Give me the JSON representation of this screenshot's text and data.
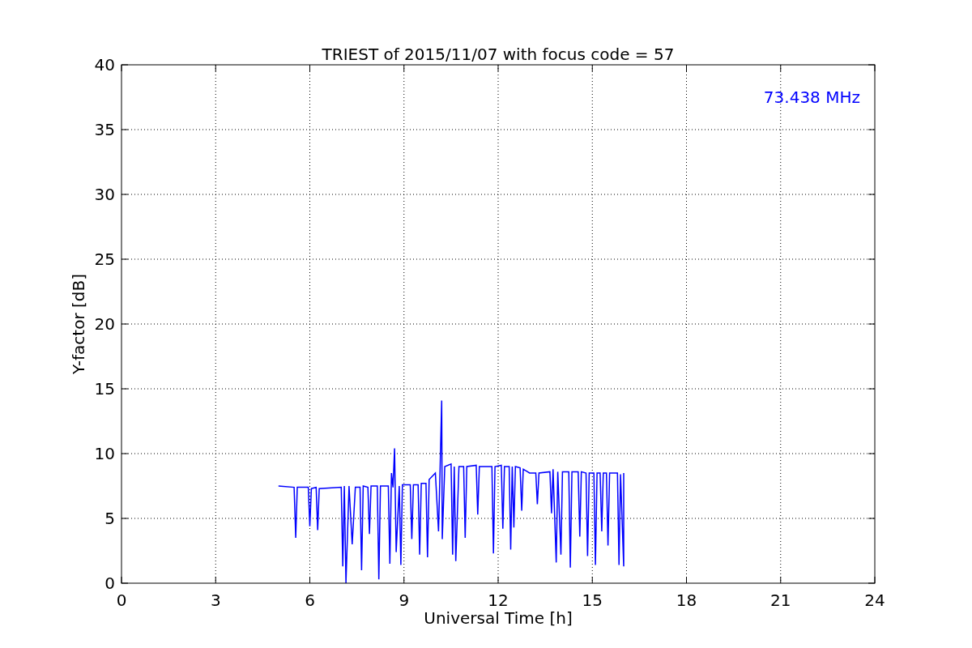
{
  "chart_data": {
    "type": "line",
    "title": "TRIEST of 2015/11/07 with focus code = 57",
    "xlabel": "Universal Time [h]",
    "ylabel": "Y-factor [dB]",
    "xlim": [
      0,
      24
    ],
    "ylim": [
      0,
      40
    ],
    "xticks": [
      0,
      3,
      6,
      9,
      12,
      15,
      18,
      21,
      24
    ],
    "yticks": [
      0,
      5,
      10,
      15,
      20,
      25,
      30,
      35,
      40
    ],
    "x": [
      5.0,
      5.5,
      5.55,
      5.6,
      5.95,
      6.0,
      6.05,
      6.2,
      6.25,
      6.3,
      7.0,
      7.05,
      7.1,
      7.15,
      7.25,
      7.35,
      7.45,
      7.6,
      7.65,
      7.7,
      7.85,
      7.9,
      7.95,
      8.15,
      8.2,
      8.25,
      8.5,
      8.55,
      8.6,
      8.65,
      8.7,
      8.75,
      8.85,
      8.9,
      8.95,
      9.2,
      9.25,
      9.3,
      9.45,
      9.5,
      9.55,
      9.7,
      9.75,
      9.8,
      10.0,
      10.1,
      10.15,
      10.2,
      10.22,
      10.3,
      10.5,
      10.55,
      10.6,
      10.65,
      10.75,
      10.9,
      10.95,
      11.0,
      11.3,
      11.35,
      11.4,
      11.8,
      11.85,
      11.9,
      12.1,
      12.15,
      12.2,
      12.35,
      12.4,
      12.45,
      12.5,
      12.55,
      12.7,
      12.75,
      12.8,
      13.0,
      13.2,
      13.25,
      13.3,
      13.65,
      13.7,
      13.75,
      13.85,
      13.9,
      14.0,
      14.05,
      14.25,
      14.3,
      14.35,
      14.55,
      14.6,
      14.65,
      14.8,
      14.85,
      14.9,
      15.05,
      15.1,
      15.15,
      15.25,
      15.3,
      15.35,
      15.45,
      15.5,
      15.55,
      15.8,
      15.85,
      15.9,
      16.0,
      16.0
    ],
    "series": [
      {
        "color": "#0000ff",
        "values": [
          7.5,
          7.4,
          3.5,
          7.4,
          7.4,
          4.4,
          7.3,
          7.4,
          4.1,
          7.3,
          7.4,
          1.3,
          7.5,
          0,
          7.5,
          3.0,
          7.4,
          7.4,
          1.0,
          7.5,
          7.4,
          3.8,
          7.5,
          7.5,
          0.3,
          7.5,
          7.5,
          1.5,
          8.5,
          7.4,
          10.4,
          2.4,
          7.5,
          1.4,
          7.6,
          7.6,
          3.4,
          7.6,
          7.6,
          2.2,
          7.7,
          7.7,
          2.0,
          8.0,
          8.5,
          4.0,
          8.8,
          14.1,
          3.4,
          9.0,
          9.2,
          2.2,
          9.0,
          1.7,
          9.0,
          9.0,
          3.5,
          9.0,
          9.1,
          5.3,
          9.0,
          9.0,
          2.3,
          9.0,
          9.1,
          4.2,
          9.0,
          9.0,
          2.6,
          9.0,
          4.3,
          9.0,
          8.9,
          5.6,
          8.8,
          8.5,
          8.5,
          6.1,
          8.5,
          8.6,
          5.4,
          8.8,
          1.6,
          8.6,
          2.2,
          8.6,
          8.6,
          1.2,
          8.6,
          8.6,
          3.6,
          8.6,
          8.5,
          2.1,
          8.5,
          8.5,
          1.4,
          8.5,
          8.5,
          4.0,
          8.5,
          8.5,
          2.9,
          8.5,
          8.5,
          1.4,
          8.4,
          1.3,
          8.5
        ]
      }
    ],
    "grid": true,
    "annotations": [
      "73.438 MHz"
    ]
  }
}
